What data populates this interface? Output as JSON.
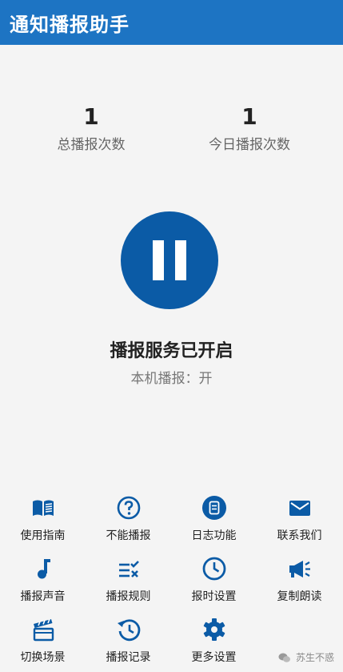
{
  "app": {
    "title": "通知播报助手"
  },
  "stats": {
    "total": {
      "value": "1",
      "label": "总播报次数"
    },
    "today": {
      "value": "1",
      "label": "今日播报次数"
    }
  },
  "toggle": {
    "icon": "pause-icon"
  },
  "status": {
    "title": "播报服务已开启",
    "subtitle": "本机播报：开"
  },
  "accent_color": "#0b5ba6",
  "appbar_color": "#1d74c3",
  "menu": [
    {
      "label": "使用指南",
      "icon": "book-icon"
    },
    {
      "label": "不能播报",
      "icon": "help-circle-icon"
    },
    {
      "label": "日志功能",
      "icon": "log-icon"
    },
    {
      "label": "联系我们",
      "icon": "mail-icon"
    },
    {
      "label": "播报声音",
      "icon": "music-note-icon"
    },
    {
      "label": "播报规则",
      "icon": "rules-list-icon"
    },
    {
      "label": "报时设置",
      "icon": "clock-icon"
    },
    {
      "label": "复制朗读",
      "icon": "megaphone-icon"
    },
    {
      "label": "切换场景",
      "icon": "clapperboard-icon"
    },
    {
      "label": "播报记录",
      "icon": "history-icon"
    },
    {
      "label": "更多设置",
      "icon": "gear-icon"
    }
  ],
  "watermark": {
    "text": "苏生不惑"
  }
}
